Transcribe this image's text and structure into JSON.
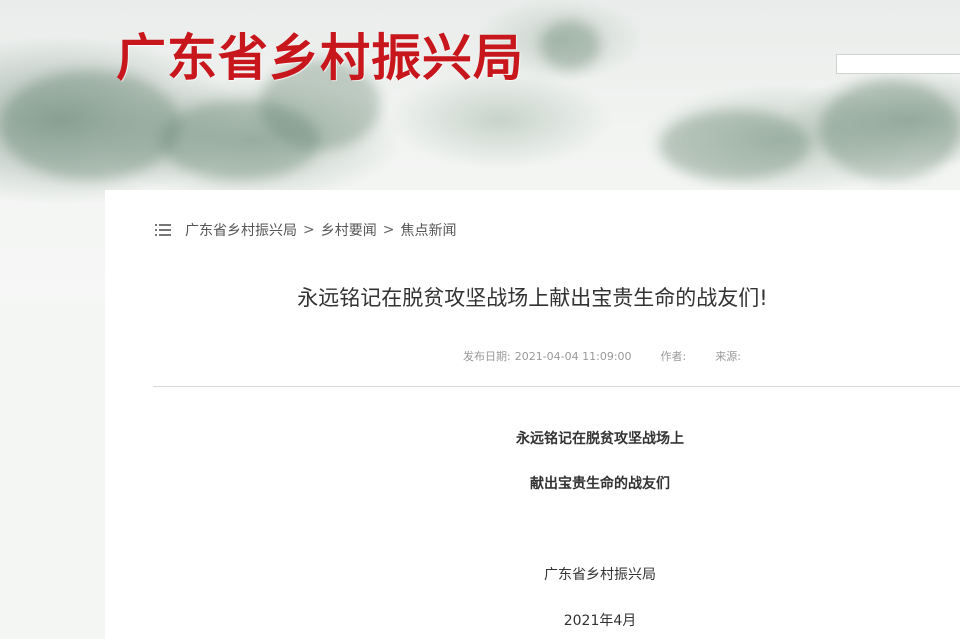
{
  "header": {
    "site_title": "广东省乡村振兴局"
  },
  "breadcrumb": {
    "items": [
      "广东省乡村振兴局",
      "乡村要闻",
      "焦点新闻"
    ],
    "separator": ">"
  },
  "article": {
    "title": "永远铭记在脱贫攻坚战场上献出宝贵生命的战友们!",
    "meta": {
      "date_label": "发布日期:",
      "date_value": "2021-04-04 11:09:00",
      "author_label": "作者:",
      "source_label": "来源:"
    },
    "body": {
      "heading_line1": "永远铭记在脱贫攻坚战场上",
      "heading_line2": "献出宝贵生命的战友们",
      "org": "广东省乡村振兴局",
      "date": "2021年4月"
    }
  },
  "colors": {
    "brand_red": "#c8161d",
    "text": "#333333",
    "muted": "#999999"
  }
}
